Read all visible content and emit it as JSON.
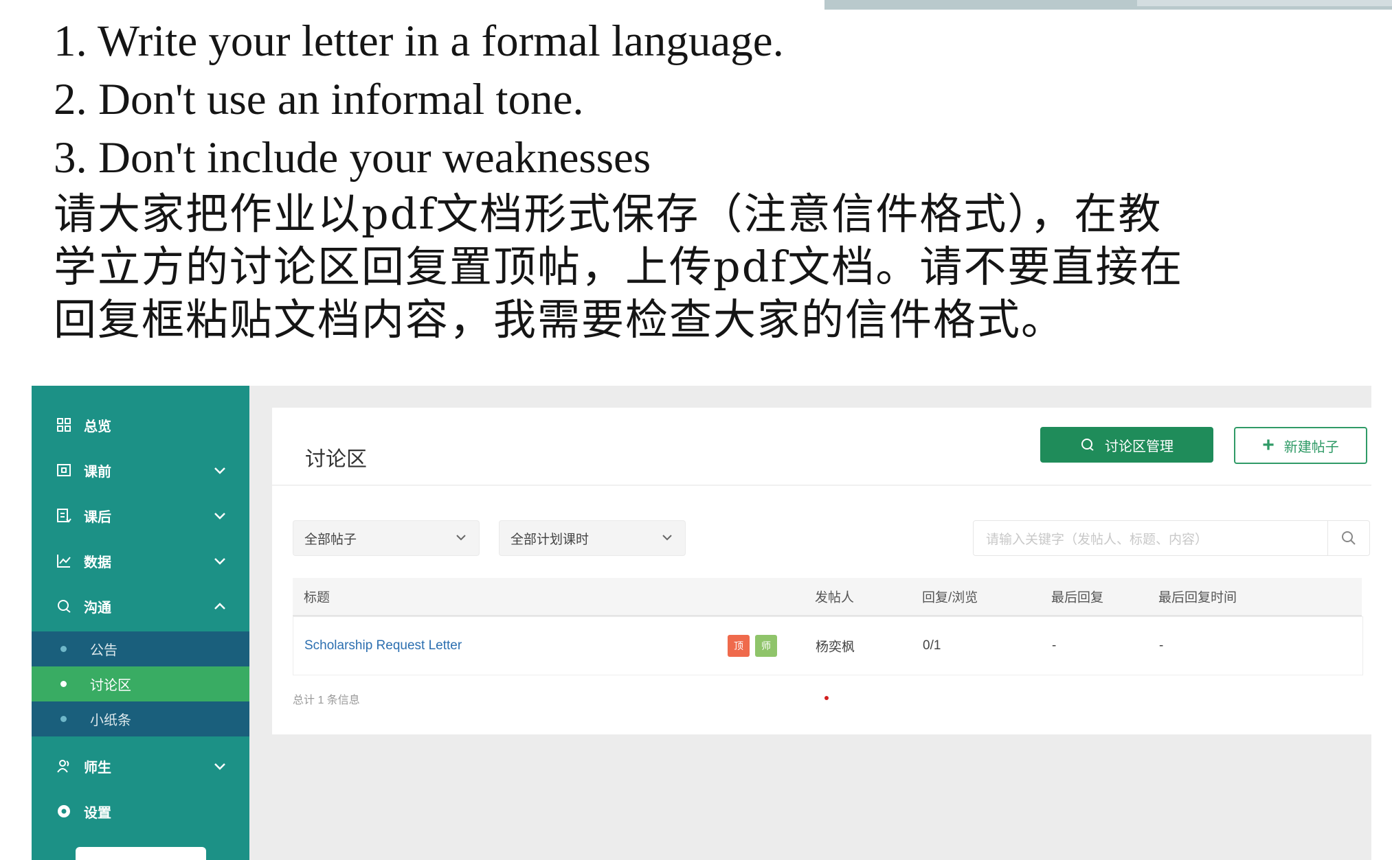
{
  "instructions": {
    "lines": [
      "1. Write your letter in a formal language.",
      "2. Don't use an informal tone.",
      "3. Don't include your weaknesses"
    ],
    "chinese": [
      "请大家把作业以pdf文档形式保存（注意信件格式），在教",
      "学立方的讨论区回复置顶帖，上传pdf文档。请不要直接在",
      "回复框粘贴文档内容，我需要检查大家的信件格式。"
    ]
  },
  "sidebar": {
    "items": [
      {
        "label": "总览",
        "icon": "grid-icon"
      },
      {
        "label": "课前",
        "icon": "calendar-icon"
      },
      {
        "label": "课后",
        "icon": "list-icon"
      },
      {
        "label": "数据",
        "icon": "chart-icon"
      },
      {
        "label": "沟通",
        "icon": "chat-icon"
      },
      {
        "label": "师生",
        "icon": "people-icon"
      },
      {
        "label": "设置",
        "icon": "gear-icon"
      }
    ],
    "subitems": [
      {
        "label": "公告"
      },
      {
        "label": "讨论区"
      },
      {
        "label": "小纸条"
      }
    ]
  },
  "panel": {
    "title": "讨论区",
    "manage_label": "讨论区管理",
    "new_post_label": "新建帖子"
  },
  "filters": {
    "posts_select": "全部帖子",
    "schedule_select": "全部计划课时",
    "search_placeholder": "请输入关键字（发帖人、标题、内容）"
  },
  "table": {
    "columns": [
      "标题",
      "发帖人",
      "回复/浏览",
      "最后回复",
      "最后回复时间"
    ],
    "rows": [
      {
        "title": "Scholarship Request Letter",
        "tags": [
          "顶",
          "师"
        ],
        "author": "杨奕枫",
        "replies_views": "0/1",
        "last_reply": "-",
        "last_reply_time": "-"
      }
    ],
    "total": "总计 1 条信息"
  },
  "colors": {
    "sidebar": "#1c9186",
    "sub_dark": "#1a5f7c",
    "sub_active": "#39ac63",
    "primary": "#1f8c5a",
    "tag_top": "#ef6a4c",
    "tag_teacher": "#8fc46a"
  }
}
